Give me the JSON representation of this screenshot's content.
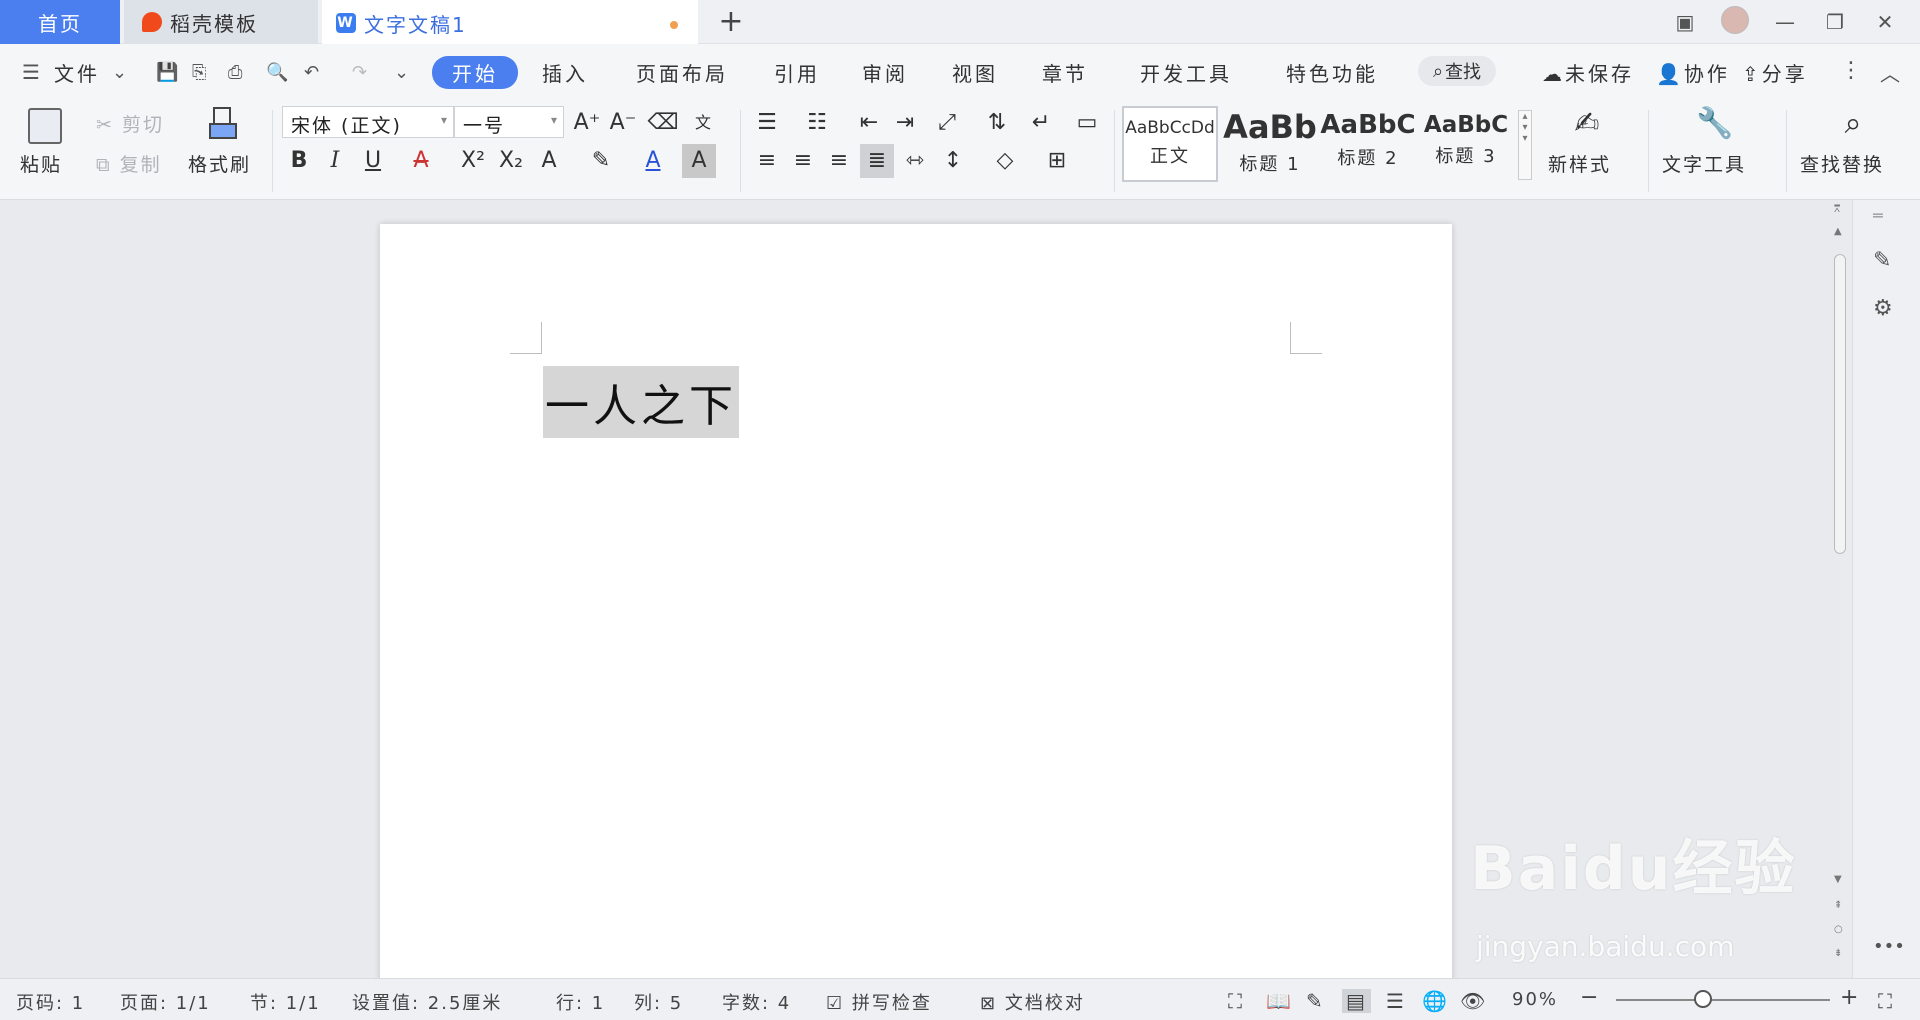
{
  "tabs": {
    "home": "首页",
    "daoke": "稻壳模板",
    "doc": "文字文稿1"
  },
  "menu": {
    "file": "文件",
    "items": [
      "开始",
      "插入",
      "页面布局",
      "引用",
      "审阅",
      "视图",
      "章节",
      "开发工具",
      "特色功能"
    ],
    "search": "查找",
    "unsaved": "未保存",
    "collab": "协作",
    "share": "分享"
  },
  "ribbon": {
    "paste": "粘贴",
    "cut": "剪切",
    "copy": "复制",
    "format_painter": "格式刷",
    "font_name": "宋体 (正文)",
    "font_size": "一号",
    "styles": [
      {
        "sample": "AaBbCcDd",
        "name": "正文"
      },
      {
        "sample": "AaBb",
        "name": "标题 1"
      },
      {
        "sample": "AaBbC",
        "name": "标题 2"
      },
      {
        "sample": "AaBbC",
        "name": "标题 3"
      }
    ],
    "new_style": "新样式",
    "text_tools": "文字工具",
    "find_replace": "查找替换"
  },
  "document": {
    "text": "一人之下"
  },
  "status": {
    "page_no": "页码: 1",
    "page": "页面: 1/1",
    "section": "节: 1/1",
    "setting": "设置值: 2.5厘米",
    "row": "行: 1",
    "col": "列: 5",
    "word_count": "字数: 4",
    "spell_check": "拼写检查",
    "doc_proof": "文档校对",
    "zoom": "90%"
  },
  "watermark": {
    "logo": "Baidu经验",
    "url": "jingyan.baidu.com"
  }
}
